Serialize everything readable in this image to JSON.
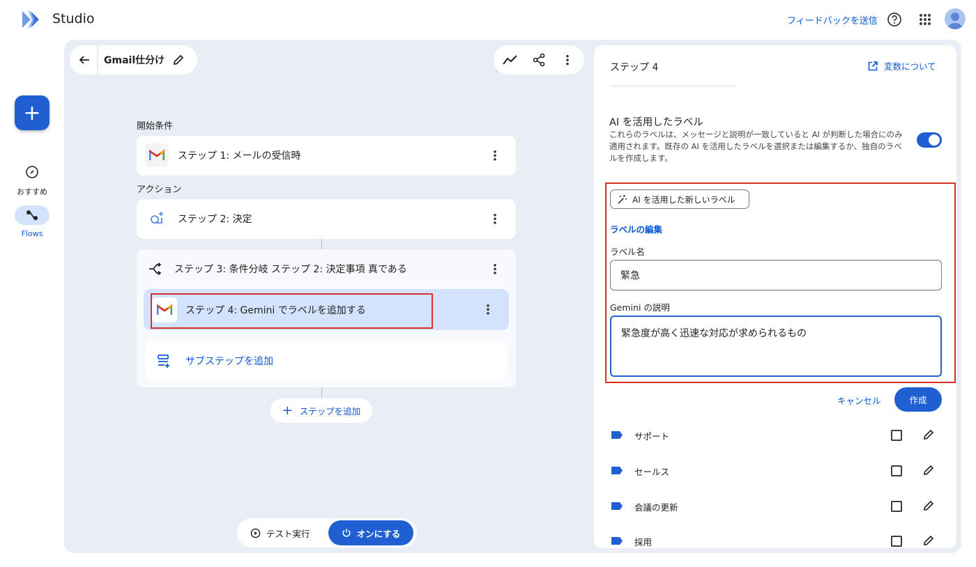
{
  "app": {
    "brand": "Studio",
    "feedback": "フィードバックを送信"
  },
  "rail": {
    "items": [
      {
        "label": "おすすめ"
      },
      {
        "label": "Flows"
      }
    ]
  },
  "flow": {
    "title": "Gmail仕分け",
    "start_label": "開始条件",
    "action_label": "アクション",
    "steps": [
      {
        "text": "ステップ 1: メールの受信時"
      },
      {
        "text": "ステップ 2: 決定"
      },
      {
        "text": "ステップ 3: 条件分岐 ステップ 2: 決定事項 真である"
      },
      {
        "text": "ステップ 4: Gemini でラベルを追加する"
      }
    ],
    "add_substep": "サブステップを追加",
    "add_step": "ステップを追加",
    "test_run": "テスト実行",
    "turn_on": "オンにする"
  },
  "panel": {
    "title": "ステップ 4",
    "variables_link": "変数について",
    "ai_label_heading": "AI を活用したラベル",
    "ai_label_desc": "これらのラベルは、メッセージと説明が一致していると AI が判断した場合にのみ適用されます。既存の AI を活用したラベルを選択または編集するか、独自のラベルを作成します。",
    "toggle_on": true,
    "new_label_button": "AI を活用した新しいラベル",
    "edit_heading": "ラベルの編集",
    "name_label": "ラベル名",
    "name_value": "緊急",
    "desc_label": "Gemini の説明",
    "desc_value": "緊急度が高く迅速な対応が求められるもの",
    "cancel": "キャンセル",
    "create": "作成",
    "labels": [
      {
        "name": "サポート",
        "checked": false
      },
      {
        "name": "セールス",
        "checked": false
      },
      {
        "name": "会議の更新",
        "checked": false
      },
      {
        "name": "採用",
        "checked": false
      }
    ]
  },
  "colors": {
    "accent": "#0b57d0",
    "highlight": "#d3e3fd",
    "canvas": "#e9eef6",
    "annotation": "#d93025"
  }
}
